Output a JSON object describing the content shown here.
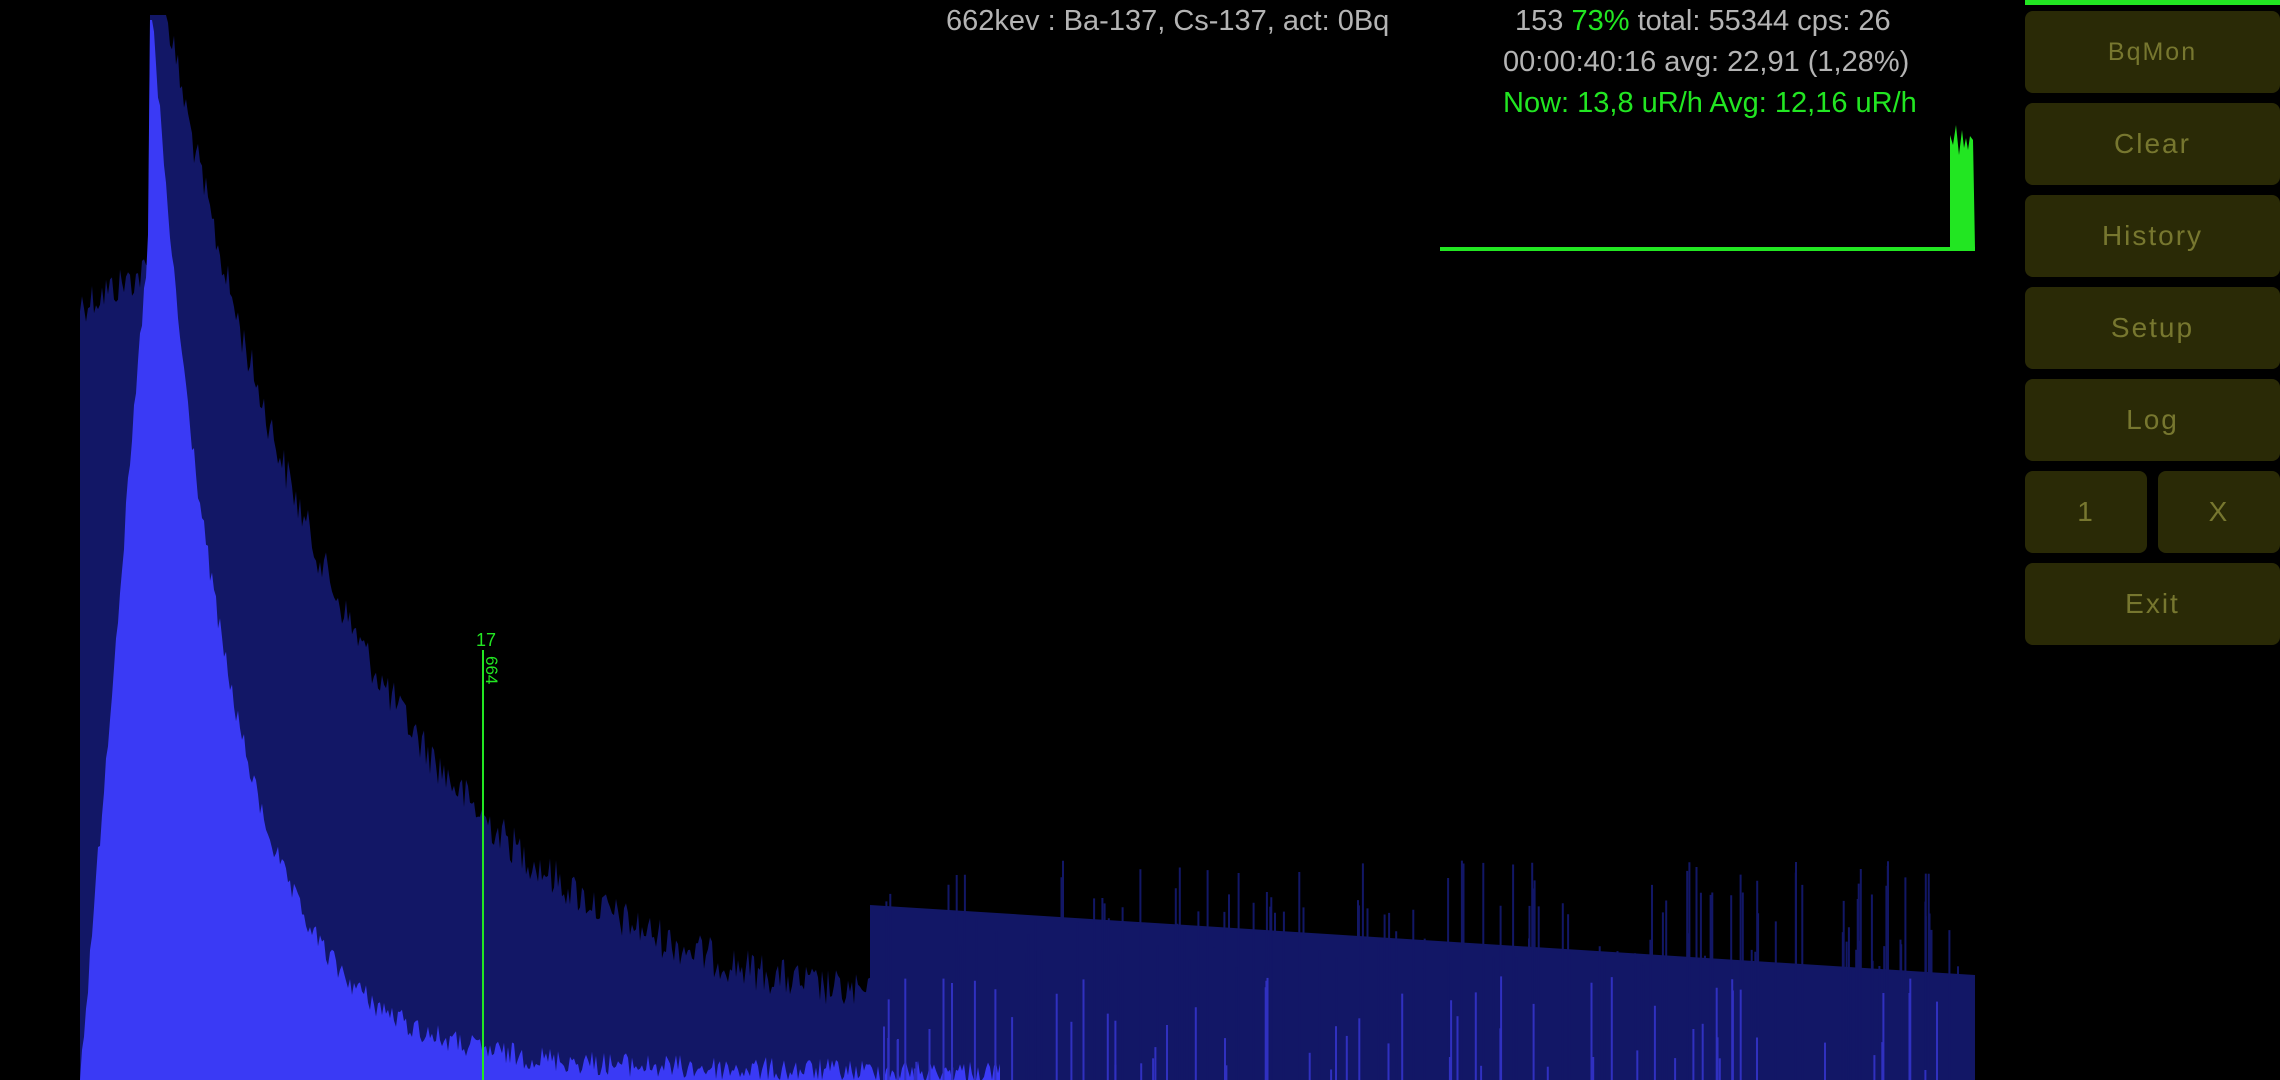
{
  "header": {
    "isotope": "662kev : Ba-137, Cs-137, act: 0Bq",
    "counts_prefix": "153",
    "counts_percent": "73%",
    "counts_suffix": "total: 55344 cps: 26",
    "time": "00:00:40:16 avg: 22,91 (1,28%)",
    "dose": "Now: 13,8 uR/h Avg: 12,16 uR/h"
  },
  "cursor": {
    "count": "17",
    "energy": "664"
  },
  "buttons": {
    "bqmon": "BqMon",
    "clear": "Clear",
    "history": "History",
    "setup": "Setup",
    "log": "Log",
    "one": "1",
    "x": "X",
    "exit": "Exit"
  },
  "colors": {
    "background": "#000000",
    "spectrum_fill": "#3a3af5",
    "spectrum_background_fill": "#121766",
    "accent_green": "#22e622",
    "info_text": "#b4b4b4",
    "button_bg": "#2a2a06",
    "button_text": "#77772f"
  }
}
